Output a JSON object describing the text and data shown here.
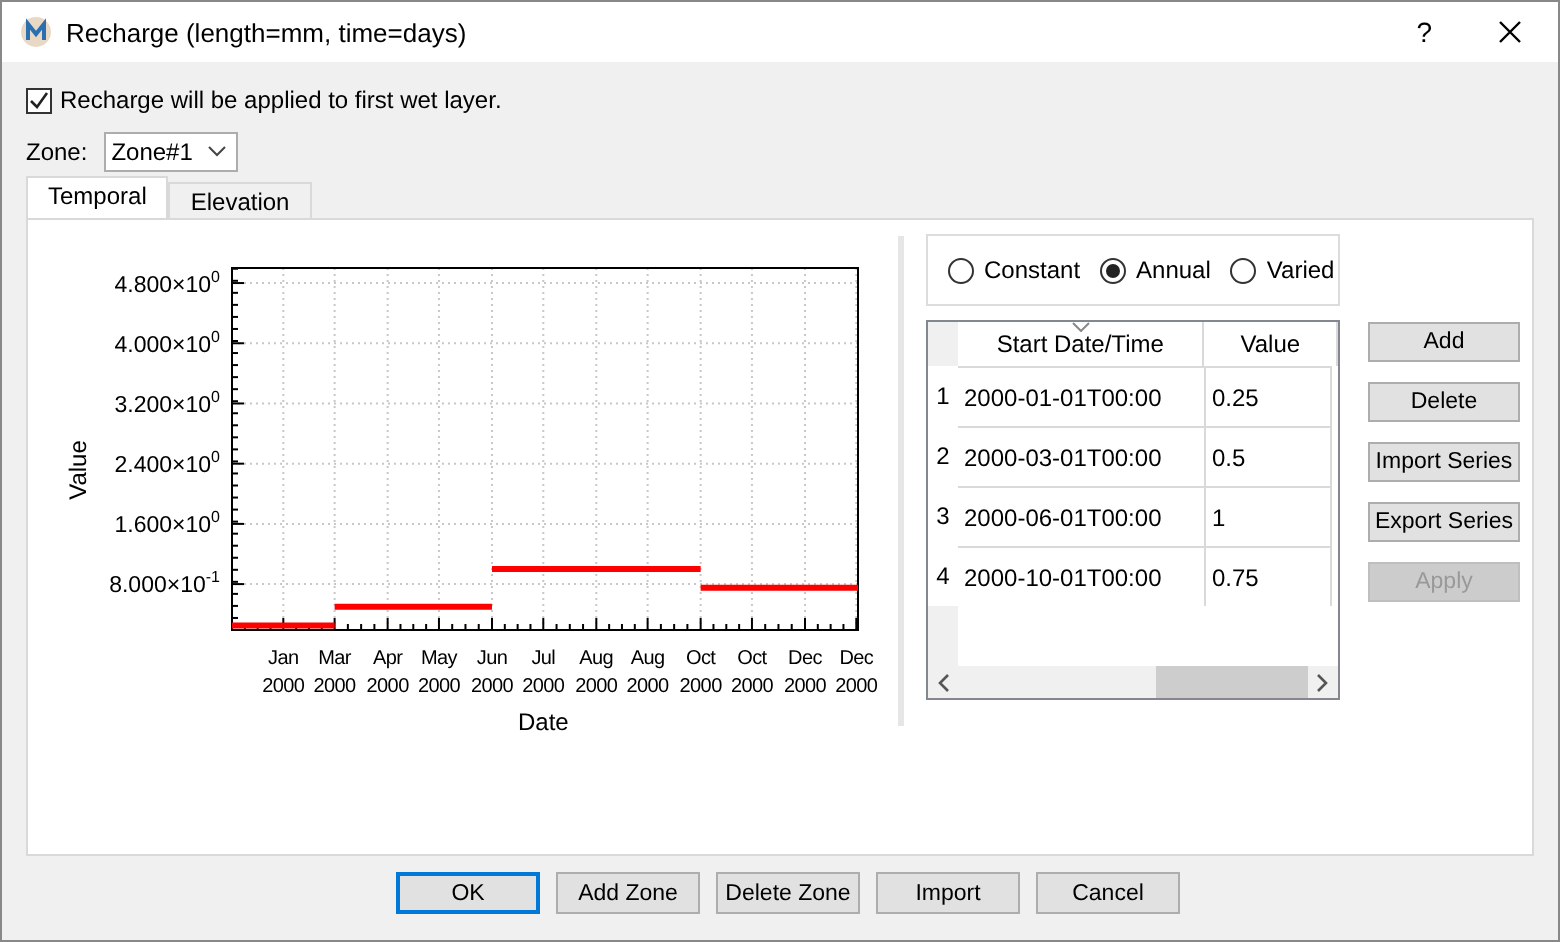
{
  "window": {
    "title": "Recharge (length=mm, time=days)",
    "help": "?"
  },
  "apply_to_wet_layer": {
    "label": "Recharge will be applied to first wet layer.",
    "checked": true
  },
  "zone": {
    "label": "Zone:",
    "value": "Zone#1"
  },
  "tabs": [
    {
      "label": "Temporal",
      "selected": true
    },
    {
      "label": "Elevation",
      "selected": false
    }
  ],
  "chart": {
    "chart_data": {
      "type": "line",
      "grid": true,
      "xlabel": "Date",
      "ylabel": "Value",
      "xlim": [
        "2000-01-01",
        "2001-01-01"
      ],
      "ylim": [
        0.19,
        5.0
      ],
      "x": [
        "2000-01-01",
        "2000-03-01",
        "2000-03-01",
        "2000-06-01",
        "2000-06-01",
        "2000-10-01",
        "2000-10-01",
        "2001-01-01"
      ],
      "series": [
        {
          "color": "#ff0000",
          "values": [
            0.25,
            0.25,
            0.5,
            0.5,
            1,
            1,
            0.75,
            0.75
          ]
        }
      ],
      "xticks": [
        {
          "value": "2000-01-31",
          "label": "Jan 2000"
        },
        {
          "value": "2000-03-01",
          "label": "Mar 2000"
        },
        {
          "value": "2000-04-01",
          "label": "Apr 2000"
        },
        {
          "value": "2000-05-01",
          "label": "May 2000"
        },
        {
          "value": "2000-06-01",
          "label": "Jun 2000"
        },
        {
          "value": "2000-07-01",
          "label": "Jul 2000"
        },
        {
          "value": "2000-08-01",
          "label": "Aug 2000"
        },
        {
          "value": "2000-08-31",
          "label": "Aug 2000"
        },
        {
          "value": "2000-10-01",
          "label": "Oct 2000"
        },
        {
          "value": "2000-10-31",
          "label": "Oct 2000"
        },
        {
          "value": "2000-12-01",
          "label": "Dec 2000"
        },
        {
          "value": "2000-12-31",
          "label": "Dec 2000"
        }
      ],
      "yticks": [
        {
          "value": 4.8,
          "label": "4.800×10$^{0}$"
        },
        {
          "value": 4.0,
          "label": "4.000×10$^{0}$"
        },
        {
          "value": 3.2,
          "label": "3.200×10$^{0}$"
        },
        {
          "value": 2.4,
          "label": "2.400×10$^{0}$"
        },
        {
          "value": 1.6,
          "label": "1.600×10$^{0}$"
        },
        {
          "value": 0.8,
          "label": "8.000×10$^{-1}$"
        }
      ]
    }
  },
  "mode": [
    {
      "label": "Constant",
      "selected": false
    },
    {
      "label": "Annual",
      "selected": true
    },
    {
      "label": "Varied",
      "selected": false
    }
  ],
  "table": {
    "columns": [
      "Start Date/Time",
      "Value"
    ],
    "rows": [
      {
        "index": "1",
        "cells": [
          "2000-01-01T00:00",
          "0.25"
        ]
      },
      {
        "index": "2",
        "cells": [
          "2000-03-01T00:00",
          "0.5"
        ]
      },
      {
        "index": "3",
        "cells": [
          "2000-06-01T00:00",
          "1"
        ]
      },
      {
        "index": "4",
        "cells": [
          "2000-10-01T00:00",
          "0.75"
        ]
      }
    ]
  },
  "side_buttons": [
    {
      "label": "Add",
      "disabled": false
    },
    {
      "label": "Delete",
      "disabled": false
    },
    {
      "label": "Import Series",
      "disabled": false
    },
    {
      "label": "Export Series",
      "disabled": false
    },
    {
      "label": "Apply",
      "disabled": true
    }
  ],
  "footer_buttons": [
    {
      "label": "OK",
      "default": true
    },
    {
      "label": "Add Zone",
      "default": false
    },
    {
      "label": "Delete Zone",
      "default": false
    },
    {
      "label": "Import",
      "default": false
    },
    {
      "label": "Cancel",
      "default": false
    }
  ]
}
